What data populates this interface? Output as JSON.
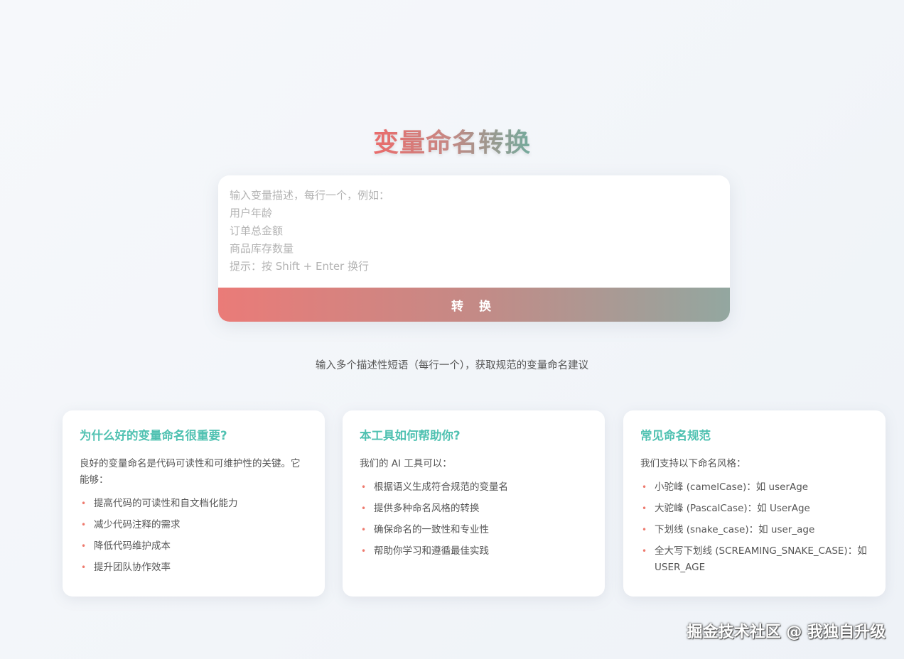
{
  "title": "变量命名转换",
  "input": {
    "placeholder": "输入变量描述，每行一个，例如：\n用户年龄\n订单总金额\n商品库存数量\n提示：按 Shift + Enter 换行"
  },
  "convert_button": "转 换",
  "subtitle": "输入多个描述性短语（每行一个），获取规范的变量命名建议",
  "cards": [
    {
      "title": "为什么好的变量命名很重要?",
      "intro": "良好的变量命名是代码可读性和可维护性的关键。它能够：",
      "items": [
        "提高代码的可读性和自文档化能力",
        "减少代码注释的需求",
        "降低代码维护成本",
        "提升团队协作效率"
      ]
    },
    {
      "title": "本工具如何帮助你?",
      "intro": "我们的 AI 工具可以：",
      "items": [
        "根据语义生成符合规范的变量名",
        "提供多种命名风格的转换",
        "确保命名的一致性和专业性",
        "帮助你学习和遵循最佳实践"
      ]
    },
    {
      "title": "常见命名规范",
      "intro": "我们支持以下命名风格：",
      "items": [
        "小驼峰 (camelCase)：如 userAge",
        "大驼峰 (PascalCase)：如 UserAge",
        "下划线 (snake_case)：如 user_age",
        "全大写下划线 (SCREAMING_SNAKE_CASE)：如 USER_AGE"
      ]
    }
  ],
  "watermark": "掘金技术社区 @ 我独自升级",
  "colors": {
    "accent_teal": "#4fc1b1",
    "accent_coral": "#ea6b6b",
    "bullet": "#ee7a6e"
  }
}
